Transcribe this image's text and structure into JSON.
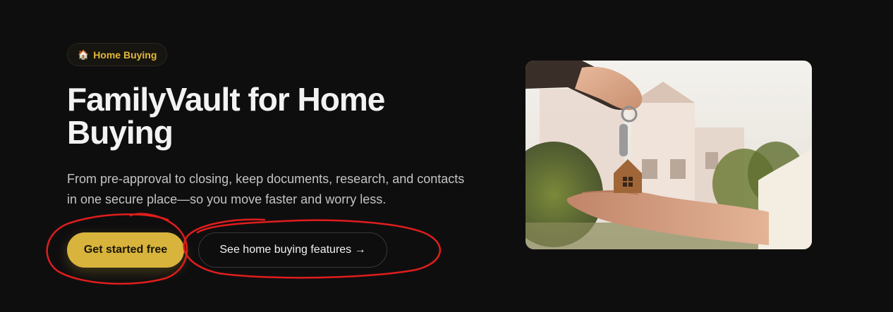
{
  "badge": {
    "icon": "house-emoji-icon",
    "glyph": "🏠",
    "label": "Home Buying"
  },
  "hero": {
    "title_line1": "FamilyVault for Home",
    "title_line2": "Buying",
    "subtitle_line1": "From pre-approval to closing, keep documents, research, and contacts",
    "subtitle_line2": "in one secure place—so you move faster and worry less."
  },
  "buttons": {
    "primary_label": "Get started free",
    "secondary_label": "See home buying features →"
  },
  "image": {
    "subject": "hand-handing-house-keychain-photo"
  },
  "colors": {
    "background": "#0f0e0f",
    "accent": "#d8b43c",
    "badge_text": "#e2b93b",
    "annotation": "#e01d1d"
  }
}
